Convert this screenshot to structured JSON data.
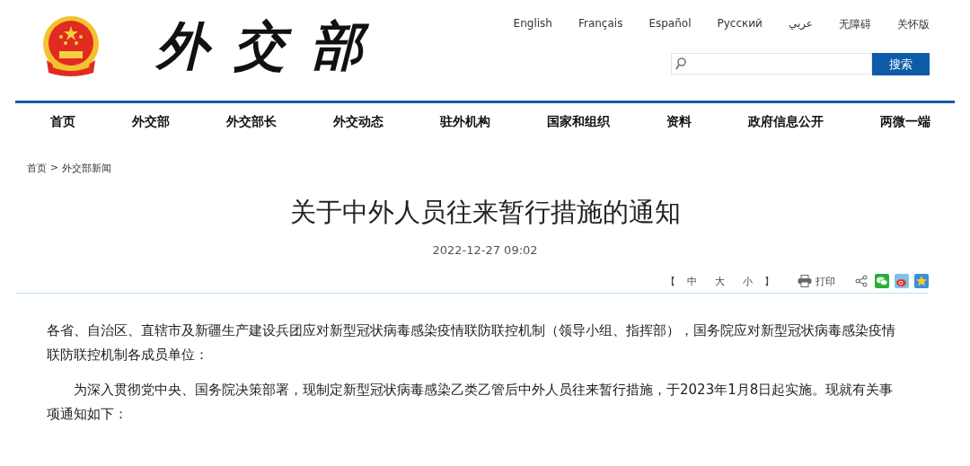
{
  "header": {
    "logo_text": "外交部",
    "languages": [
      {
        "label": "English"
      },
      {
        "label": "Français"
      },
      {
        "label": "Español"
      },
      {
        "label": "Русский"
      },
      {
        "label": "عربي"
      },
      {
        "label": "无障碍"
      },
      {
        "label": "关怀版"
      }
    ],
    "search": {
      "button": "搜索"
    }
  },
  "nav": [
    {
      "label": "首页"
    },
    {
      "label": "外交部"
    },
    {
      "label": "外交部长"
    },
    {
      "label": "外交动态"
    },
    {
      "label": "驻外机构"
    },
    {
      "label": "国家和组织"
    },
    {
      "label": "资料"
    },
    {
      "label": "政府信息公开"
    },
    {
      "label": "两微一端"
    }
  ],
  "breadcrumb": {
    "items": [
      "首页",
      "外交部新闻"
    ],
    "separator": ">"
  },
  "article": {
    "title": "关于中外人员往来暂行措施的通知",
    "date": "2022-12-27 09:02",
    "font_size": {
      "open": "【",
      "options": [
        "中",
        "大",
        "小"
      ],
      "close": "】"
    },
    "print": "打印",
    "paragraphs": [
      {
        "text": "各省、自治区、直辖市及新疆生产建设兵团应对新型冠状病毒感染疫情联防联控机制（领导小组、指挥部），国务院应对新型冠状病毒感染疫情联防联控机制各成员单位：",
        "indent": false
      },
      {
        "text": "为深入贯彻党中央、国务院决策部署，现制定新型冠状病毒感染乙类乙管后中外人员往来暂行措施，于2023年1月8日起实施。现就有关事项通知如下：",
        "indent": true
      }
    ]
  }
}
